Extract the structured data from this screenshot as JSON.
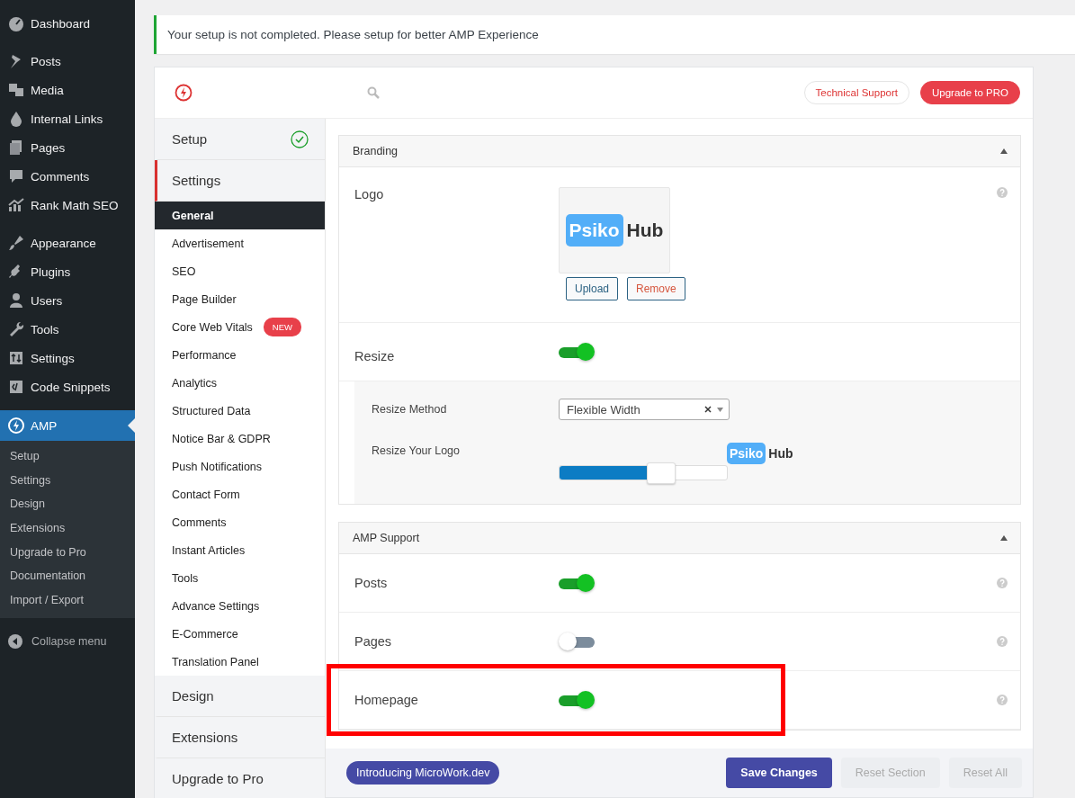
{
  "admin_menu": {
    "groups": [
      [
        {
          "label": "Dashboard",
          "selected": false
        }
      ],
      [
        {
          "label": "Posts",
          "selected": false
        },
        {
          "label": "Media",
          "selected": false
        },
        {
          "label": "Internal Links",
          "selected": false
        },
        {
          "label": "Pages",
          "selected": false
        },
        {
          "label": "Comments",
          "selected": false
        },
        {
          "label": "Rank Math SEO",
          "selected": false
        }
      ],
      [
        {
          "label": "Appearance",
          "selected": false
        },
        {
          "label": "Plugins",
          "selected": false
        },
        {
          "label": "Users",
          "selected": false
        },
        {
          "label": "Tools",
          "selected": false
        },
        {
          "label": "Settings",
          "selected": false
        },
        {
          "label": "Code Snippets",
          "selected": false
        },
        {
          "label": "AMP",
          "selected": true,
          "children": [
            "Setup",
            "Settings",
            "Design",
            "Extensions",
            "Upgrade to Pro",
            "Documentation",
            "Import / Export"
          ]
        }
      ]
    ],
    "collapse": "Collapse menu"
  },
  "notice": "Your setup is not completed. Please setup for better AMP Experience",
  "panel": {
    "header_buttons": [
      {
        "label": "Technical Support",
        "kind": "outline"
      },
      {
        "label": "Upgrade to PRO",
        "kind": "filled"
      }
    ],
    "nav": [
      {
        "label": "Setup",
        "completed": true,
        "selected": false
      },
      {
        "label": "Settings",
        "completed": false,
        "selected": true,
        "children": [
          {
            "label": "General",
            "selected": true
          },
          {
            "label": "Advertisement",
            "selected": false
          },
          {
            "label": "SEO",
            "selected": false
          },
          {
            "label": "Page Builder",
            "selected": false
          },
          {
            "label": "Core Web Vitals",
            "selected": false,
            "badge": "NEW"
          },
          {
            "label": "Performance",
            "selected": false
          },
          {
            "label": "Analytics",
            "selected": false
          },
          {
            "label": "Structured Data",
            "selected": false
          },
          {
            "label": "Notice Bar & GDPR",
            "selected": false
          },
          {
            "label": "Push Notifications",
            "selected": false
          },
          {
            "label": "Contact Form",
            "selected": false
          },
          {
            "label": "Comments",
            "selected": false
          },
          {
            "label": "Instant Articles",
            "selected": false
          },
          {
            "label": "Tools",
            "selected": false
          },
          {
            "label": "Advance Settings",
            "selected": false
          },
          {
            "label": "E-Commerce",
            "selected": false
          },
          {
            "label": "Translation Panel",
            "selected": false
          }
        ]
      },
      {
        "label": "Design",
        "completed": false,
        "selected": false
      },
      {
        "label": "Extensions",
        "completed": false,
        "selected": false
      },
      {
        "label": "Upgrade to Pro",
        "completed": false,
        "selected": false
      }
    ],
    "sections": [
      {
        "title": "Branding",
        "expanded": true,
        "rows": [
          {
            "kind": "logo",
            "label": "Logo",
            "logo": [
              "Psiko",
              "Hub"
            ],
            "buttons": [
              "Upload",
              "Remove"
            ]
          },
          {
            "kind": "toggle",
            "label": "Resize",
            "on": true,
            "help": false
          },
          {
            "kind": "select",
            "label": "Resize Method",
            "value": "Flexible Width"
          },
          {
            "kind": "slider",
            "label": "Resize Your Logo",
            "level": 0.6,
            "logo": [
              "Psiko",
              "Hub"
            ]
          }
        ]
      },
      {
        "title": "AMP Support",
        "expanded": true,
        "rows": [
          {
            "kind": "toggle",
            "label": "Posts",
            "on": true,
            "help": true
          },
          {
            "kind": "toggle",
            "label": "Pages",
            "on": false,
            "help": true
          },
          {
            "kind": "toggle",
            "label": "Homepage",
            "on": true,
            "help": true,
            "highlighted": true
          }
        ]
      }
    ],
    "footer": {
      "promo": "Introducing MicroWork.dev",
      "buttons": [
        {
          "label": "Save Changes",
          "disabled": false
        },
        {
          "label": "Reset Section",
          "disabled": true
        },
        {
          "label": "Reset All",
          "disabled": true
        }
      ]
    }
  }
}
